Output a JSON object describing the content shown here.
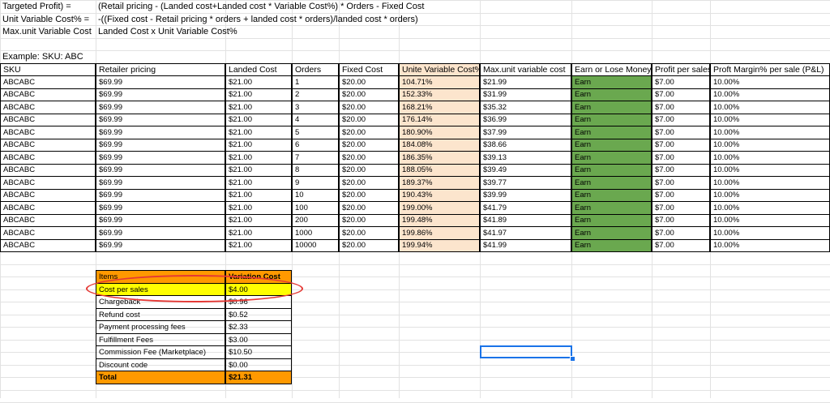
{
  "formulas": [
    {
      "label": "Targeted Profit) =",
      "expr": "(Retail pricing - (Landed cost+Landed cost * Variable Cost%) * Orders - Fixed Cost"
    },
    {
      "label": "Unit Variable Cost% =",
      "expr": "-((Fixed cost - Retail pricing * orders + landed cost * orders)/landed cost * orders)"
    },
    {
      "label": "Max.unit Variable Cost",
      "expr": "Landed Cost x Unit Variable Cost%"
    }
  ],
  "example_label": "Example: SKU: ABC",
  "table": {
    "headers": [
      "SKU",
      "Retailer pricing",
      "Landed Cost",
      "Orders",
      "Fixed Cost",
      "Unite Variable Cost%",
      "Max.unit variable cost",
      "Earn or Lose Money",
      "Profit per sales",
      "Proft Margin% per sale (P&L)"
    ],
    "rows": [
      [
        "ABCABC",
        "$69.99",
        "$21.00",
        "1",
        "$20.00",
        "104.71%",
        "$21.99",
        "Earn",
        "$7.00",
        "10.00%"
      ],
      [
        "ABCABC",
        "$69.99",
        "$21.00",
        "2",
        "$20.00",
        "152.33%",
        "$31.99",
        "Earn",
        "$7.00",
        "10.00%"
      ],
      [
        "ABCABC",
        "$69.99",
        "$21.00",
        "3",
        "$20.00",
        "168.21%",
        "$35.32",
        "Earn",
        "$7.00",
        "10.00%"
      ],
      [
        "ABCABC",
        "$69.99",
        "$21.00",
        "4",
        "$20.00",
        "176.14%",
        "$36.99",
        "Earn",
        "$7.00",
        "10.00%"
      ],
      [
        "ABCABC",
        "$69.99",
        "$21.00",
        "5",
        "$20.00",
        "180.90%",
        "$37.99",
        "Earn",
        "$7.00",
        "10.00%"
      ],
      [
        "ABCABC",
        "$69.99",
        "$21.00",
        "6",
        "$20.00",
        "184.08%",
        "$38.66",
        "Earn",
        "$7.00",
        "10.00%"
      ],
      [
        "ABCABC",
        "$69.99",
        "$21.00",
        "7",
        "$20.00",
        "186.35%",
        "$39.13",
        "Earn",
        "$7.00",
        "10.00%"
      ],
      [
        "ABCABC",
        "$69.99",
        "$21.00",
        "8",
        "$20.00",
        "188.05%",
        "$39.49",
        "Earn",
        "$7.00",
        "10.00%"
      ],
      [
        "ABCABC",
        "$69.99",
        "$21.00",
        "9",
        "$20.00",
        "189.37%",
        "$39.77",
        "Earn",
        "$7.00",
        "10.00%"
      ],
      [
        "ABCABC",
        "$69.99",
        "$21.00",
        "10",
        "$20.00",
        "190.43%",
        "$39.99",
        "Earn",
        "$7.00",
        "10.00%"
      ],
      [
        "ABCABC",
        "$69.99",
        "$21.00",
        "100",
        "$20.00",
        "199.00%",
        "$41.79",
        "Earn",
        "$7.00",
        "10.00%"
      ],
      [
        "ABCABC",
        "$69.99",
        "$21.00",
        "200",
        "$20.00",
        "199.48%",
        "$41.89",
        "Earn",
        "$7.00",
        "10.00%"
      ],
      [
        "ABCABC",
        "$69.99",
        "$21.00",
        "1000",
        "$20.00",
        "199.86%",
        "$41.97",
        "Earn",
        "$7.00",
        "10.00%"
      ],
      [
        "ABCABC",
        "$69.99",
        "$21.00",
        "10000",
        "$20.00",
        "199.94%",
        "$41.99",
        "Earn",
        "$7.00",
        "10.00%"
      ]
    ]
  },
  "cost_table": {
    "headers": [
      "Items",
      "Variation Cost"
    ],
    "rows": [
      [
        "Cost per sales",
        "$4.00"
      ],
      [
        "Chargeback",
        "$0.96"
      ],
      [
        "Refund cost",
        "$0.52"
      ],
      [
        "Payment processing fees",
        "$2.33"
      ],
      [
        "Fulfillment Fees",
        "$3.00"
      ],
      [
        "Commission Fee (Marketplace)",
        "$10.50"
      ],
      [
        "Discount code",
        "$0.00"
      ]
    ],
    "total": [
      "Total",
      "$21.31"
    ]
  },
  "colors": {
    "variable_cost_fill": "#fce5cd",
    "earn_fill": "#6aa84f",
    "header_total_fill": "#ff9900",
    "highlight_fill": "#ffff00",
    "annotation_circle": "#e53935",
    "selection": "#1a73e8"
  }
}
